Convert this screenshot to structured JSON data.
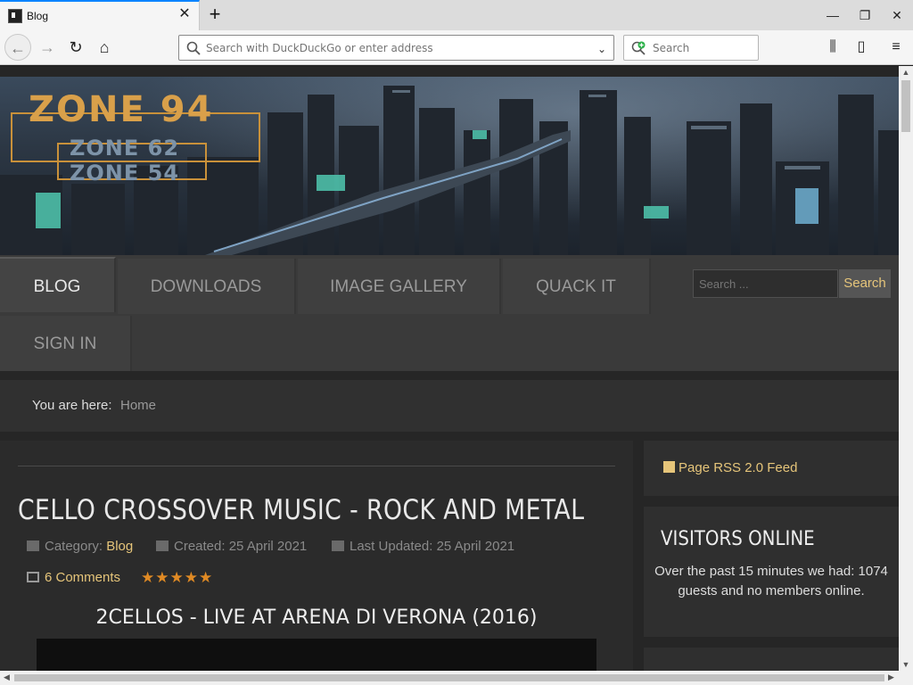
{
  "browser": {
    "tab_title": "Blog",
    "url_placeholder": "Search with DuckDuckGo or enter address",
    "search_placeholder": "Search"
  },
  "site": {
    "logo_main": "ZONE 94",
    "logo_sub1": "ZONE 62",
    "logo_sub2": "ZONE 54",
    "menu": [
      {
        "label": "BLOG"
      },
      {
        "label": "DOWNLOADS"
      },
      {
        "label": "IMAGE GALLERY"
      },
      {
        "label": "QUACK IT"
      },
      {
        "label": "SIGN IN"
      }
    ],
    "search_placeholder": "Search ...",
    "search_button": "Search",
    "breadcrumb_label": "You are here:",
    "breadcrumb_home": "Home"
  },
  "article": {
    "title": "CELLO CROSSOVER MUSIC - ROCK AND METAL",
    "category_label": "Category:",
    "category": "Blog",
    "created": "Created: 25 April 2021",
    "updated": "Last Updated: 25 April 2021",
    "comments": "6 Comments",
    "rating_stars": "★★★★★",
    "video_title": "2CELLOS - LIVE AT ARENA DI VERONA (2016)"
  },
  "sidebar": {
    "rss": "Page RSS 2.0 Feed",
    "visitors_title": "VISITORS ONLINE",
    "visitors_text": "Over the past 15 minutes we had: 1074 guests and no members online."
  },
  "colors": {
    "accent": "#e6c57a",
    "star": "#e08a24",
    "logo": "#d9a04a"
  }
}
